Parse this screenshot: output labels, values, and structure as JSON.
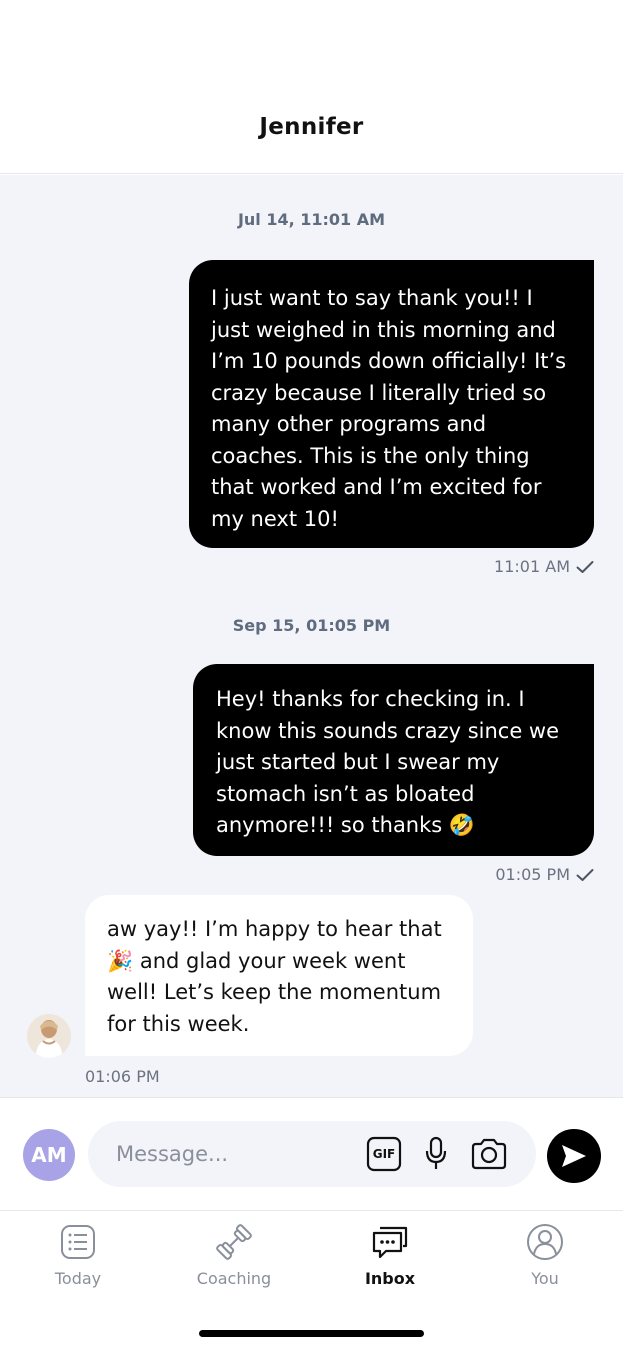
{
  "header": {
    "title": "Jennifer"
  },
  "messages": [
    {
      "date": "Jul 14, 11:01 AM",
      "direction": "outgoing",
      "lines": [
        "I just want to say thank you!! I",
        "just weighed in this morning and",
        "I’m 10 pounds down officially! It’s",
        "crazy because I literally tried so",
        "many other programs and",
        "coaches. This is the only thing",
        "that worked and I’m excited for",
        "my next 10!"
      ],
      "time": "11:01 AM",
      "status": "sent"
    },
    {
      "date": "Sep 15, 01:05 PM",
      "direction": "outgoing",
      "lines": [
        "Hey! thanks for checking in. I",
        "know this sounds crazy since we",
        "just started but I swear my",
        "stomach isn’t as bloated",
        "anymore!!! so thanks 🤣"
      ],
      "time": "01:05 PM",
      "status": "sent"
    },
    {
      "direction": "incoming",
      "lines": [
        "aw yay!! I’m happy to hear that",
        "🎉 and glad your week went",
        "well! Let’s keep the momentum",
        "for this week."
      ],
      "time": "01:06 PM"
    }
  ],
  "composer": {
    "avatar_initials": "AM",
    "placeholder": "Message...",
    "gif_label": "GIF"
  },
  "tabs": [
    {
      "label": "Today",
      "icon": "list-icon",
      "active": false
    },
    {
      "label": "Coaching",
      "icon": "dumbbell-icon",
      "active": false
    },
    {
      "label": "Inbox",
      "icon": "chat-icon",
      "active": true
    },
    {
      "label": "You",
      "icon": "user-icon",
      "active": false
    }
  ],
  "colors": {
    "outgoing_bubble": "#000000",
    "incoming_bubble": "#ffffff",
    "chat_background": "#f3f4f9",
    "avatar_bg": "#a8a3e6",
    "muted_text": "#8a8f9c"
  }
}
